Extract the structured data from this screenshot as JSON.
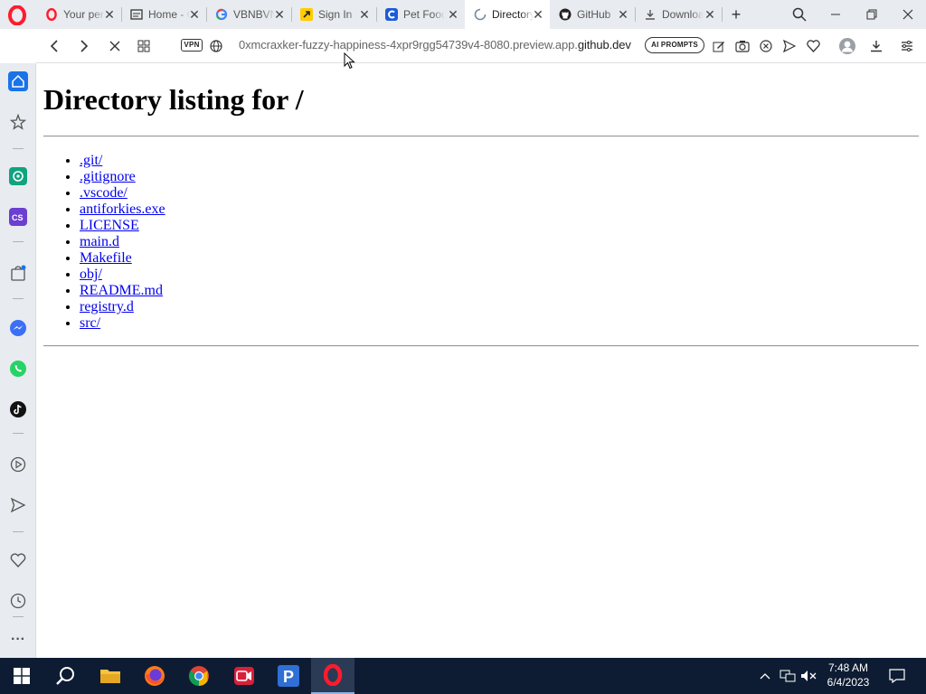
{
  "tabs": [
    {
      "title": "Your personal",
      "icon": "opera-icon"
    },
    {
      "title": "Home - Go",
      "icon": "page-icon"
    },
    {
      "title": "VBNBVNB",
      "icon": "google-icon"
    },
    {
      "title": "Sign In",
      "icon": "arrow-app-icon"
    },
    {
      "title": "Pet Food",
      "icon": "c-app-icon"
    },
    {
      "title": "Directory",
      "icon": "loading-icon"
    },
    {
      "title": "GitHub",
      "icon": "github-icon"
    },
    {
      "title": "Downloads",
      "icon": "download-icon"
    }
  ],
  "address_bar": {
    "vpn_label": "VPN",
    "url_subdomain": "0xmcraxker-fuzzy-happiness-4xpr9rgg54739v4-8080.preview.app.",
    "url_host": "github.dev",
    "ai_prompts_label": "AI PROMPTS"
  },
  "page": {
    "title": "Directory listing for /",
    "entries": [
      ".git/",
      ".gitignore",
      ".vscode/",
      "antiforkies.exe",
      "LICENSE",
      "main.d",
      "Makefile",
      "obj/",
      "README.md",
      "registry.d",
      "src/"
    ]
  },
  "taskbar": {
    "time": "7:48 AM",
    "date": "6/4/2023"
  },
  "colors": {
    "opera_red": "#ff1b2d",
    "link_blue": "#0000ee",
    "taskbar_bg": "#0e1c33",
    "sidebar_home_active": "#1a73e8"
  }
}
